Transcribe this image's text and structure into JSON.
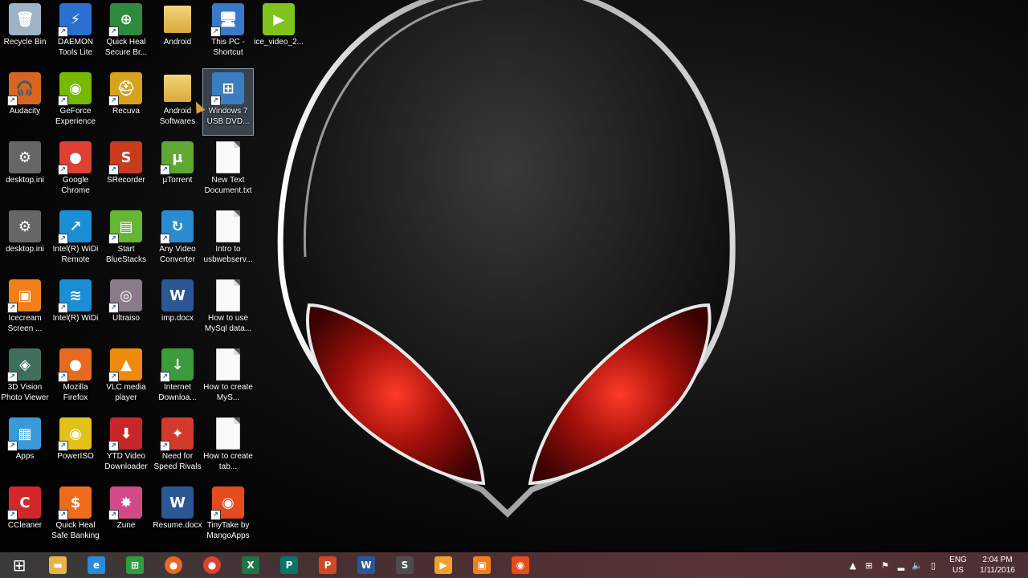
{
  "desktop": {
    "icons": [
      {
        "label": "Recycle Bin",
        "icon": "recycle-bin-icon",
        "glyph": "🗑",
        "color": "#9fb3c6"
      },
      {
        "label": "DAEMON Tools Lite",
        "icon": "daemon-tools-icon",
        "glyph": "⚡",
        "color": "#2a6fd1"
      },
      {
        "label": "Quick Heal Secure Br...",
        "icon": "quick-heal-browser-icon",
        "glyph": "⊕",
        "color": "#2e8b3d"
      },
      {
        "label": "Android",
        "icon": "folder-icon",
        "glyph": "",
        "color": "#e1b54d"
      },
      {
        "label": "This PC - Shortcut",
        "icon": "computer-icon",
        "glyph": "🖥",
        "color": "#3a78c9"
      },
      {
        "label": "ice_video_2...",
        "icon": "video-file-icon",
        "glyph": "▶",
        "color": "#7fc31c"
      },
      {
        "label": "Audacity",
        "icon": "audacity-icon",
        "glyph": "🎧",
        "color": "#d9661f"
      },
      {
        "label": "GeForce Experience",
        "icon": "geforce-icon",
        "glyph": "◉",
        "color": "#76b900"
      },
      {
        "label": "Recuva",
        "icon": "recuva-icon",
        "glyph": "⛑",
        "color": "#d8a21b"
      },
      {
        "label": "Android Softwares",
        "icon": "folder-icon",
        "glyph": "",
        "color": "#e1b54d"
      },
      {
        "label": "Windows 7 USB DVD...",
        "icon": "windows-usb-tool-icon",
        "glyph": "⊞",
        "color": "#3c7dc2"
      },
      {
        "label": "desktop.ini",
        "icon": "settings-file-icon",
        "glyph": "⚙",
        "color": "#666"
      },
      {
        "label": "Google Chrome",
        "icon": "chrome-icon",
        "glyph": "●",
        "color": "#de4032"
      },
      {
        "label": "SRecorder",
        "icon": "srecorder-icon",
        "glyph": "S",
        "color": "#c93b1c"
      },
      {
        "label": "µTorrent",
        "icon": "utorrent-icon",
        "glyph": "µ",
        "color": "#61a832"
      },
      {
        "label": "New Text Document.txt",
        "icon": "text-document-icon",
        "glyph": "",
        "color": "#fafafa"
      },
      {
        "label": "desktop.ini",
        "icon": "settings-file-icon",
        "glyph": "⚙",
        "color": "#666"
      },
      {
        "label": "Intel(R) WiDi Remote",
        "icon": "intel-widi-icon",
        "glyph": "↗",
        "color": "#1b8fd6"
      },
      {
        "label": "Start BlueStacks",
        "icon": "bluestacks-icon",
        "glyph": "▤",
        "color": "#64b634"
      },
      {
        "label": "Any Video Converter",
        "icon": "video-converter-icon",
        "glyph": "↻",
        "color": "#2a8ad2"
      },
      {
        "label": "Intro to usbwebserv...",
        "icon": "text-document-icon",
        "glyph": "",
        "color": "#fafafa"
      },
      {
        "label": "Icecream Screen ...",
        "icon": "icecream-screen-icon",
        "glyph": "▣",
        "color": "#f07f1a"
      },
      {
        "label": "Intel(R) WiDi",
        "icon": "intel-widi-icon",
        "glyph": "≋",
        "color": "#1b8fd6"
      },
      {
        "label": "Ultraiso",
        "icon": "disc-icon",
        "glyph": "◎",
        "color": "#8a7a8a"
      },
      {
        "label": "imp.docx",
        "icon": "word-document-icon",
        "glyph": "W",
        "color": "#2b5797"
      },
      {
        "label": "How to use MySql data...",
        "icon": "text-document-icon",
        "glyph": "",
        "color": "#fafafa"
      },
      {
        "label": "3D Vision Photo Viewer",
        "icon": "3d-vision-icon",
        "glyph": "◈",
        "color": "#3f6f5a"
      },
      {
        "label": "Mozilla Firefox",
        "icon": "firefox-icon",
        "glyph": "●",
        "color": "#e66a1f"
      },
      {
        "label": "VLC media player",
        "icon": "vlc-icon",
        "glyph": "▲",
        "color": "#f08a0c"
      },
      {
        "label": "Internet Downloa...",
        "icon": "idm-icon",
        "glyph": "↓",
        "color": "#3c9b3c"
      },
      {
        "label": "How to create MyS...",
        "icon": "text-document-icon",
        "glyph": "",
        "color": "#fafafa"
      },
      {
        "label": "Apps",
        "icon": "apps-icon",
        "glyph": "▦",
        "color": "#3a9ad9"
      },
      {
        "label": "PowerISO",
        "icon": "poweriso-icon",
        "glyph": "◉",
        "color": "#e2c21a"
      },
      {
        "label": "YTD Video Downloader",
        "icon": "ytd-icon",
        "glyph": "⬇",
        "color": "#c9262a"
      },
      {
        "label": "Need for Speed Rivals",
        "icon": "nfs-icon",
        "glyph": "✦",
        "color": "#d43a2c"
      },
      {
        "label": "How to create tab...",
        "icon": "text-document-icon",
        "glyph": "",
        "color": "#fafafa"
      },
      {
        "label": "CCleaner",
        "icon": "ccleaner-icon",
        "glyph": "C",
        "color": "#d2282c"
      },
      {
        "label": "Quick Heal Safe Banking",
        "icon": "quick-heal-banking-icon",
        "glyph": "$",
        "color": "#ef6c1f"
      },
      {
        "label": "Zune",
        "icon": "zune-icon",
        "glyph": "✸",
        "color": "#d34a8b"
      },
      {
        "label": "Resume.docx",
        "icon": "word-document-icon",
        "glyph": "W",
        "color": "#2b5797"
      },
      {
        "label": "TinyTake by MangoApps",
        "icon": "tinytake-icon",
        "glyph": "◉",
        "color": "#e64b1e"
      }
    ]
  },
  "taskbar": {
    "start_glyph": "⊞",
    "apps": [
      {
        "name": "file-explorer-icon",
        "glyph": "▬",
        "color": "#e3b54a"
      },
      {
        "name": "internet-explorer-icon",
        "glyph": "e",
        "color": "#2b8bd6"
      },
      {
        "name": "store-icon",
        "glyph": "⊞",
        "color": "#2e9d3c"
      },
      {
        "name": "firefox-icon",
        "glyph": "●",
        "color": "#e66a1f"
      },
      {
        "name": "chrome-icon",
        "glyph": "●",
        "color": "#de4032"
      },
      {
        "name": "excel-icon",
        "glyph": "X",
        "color": "#217346"
      },
      {
        "name": "publisher-icon",
        "glyph": "P",
        "color": "#077568"
      },
      {
        "name": "powerpoint-icon",
        "glyph": "P",
        "color": "#d24726"
      },
      {
        "name": "word-icon",
        "glyph": "W",
        "color": "#2b5797"
      },
      {
        "name": "sublime-icon",
        "glyph": "S",
        "color": "#4d4d4d"
      },
      {
        "name": "media-player-icon",
        "glyph": "▶",
        "color": "#f0a030"
      },
      {
        "name": "icecream-recorder-icon",
        "glyph": "▣",
        "color": "#f07f1a"
      },
      {
        "name": "tinytake-icon",
        "glyph": "◉",
        "color": "#e64b1e"
      }
    ],
    "tray": {
      "lang_line1": "ENG",
      "lang_line2": "US",
      "time": "2:04 PM",
      "date": "1/11/2016"
    }
  }
}
